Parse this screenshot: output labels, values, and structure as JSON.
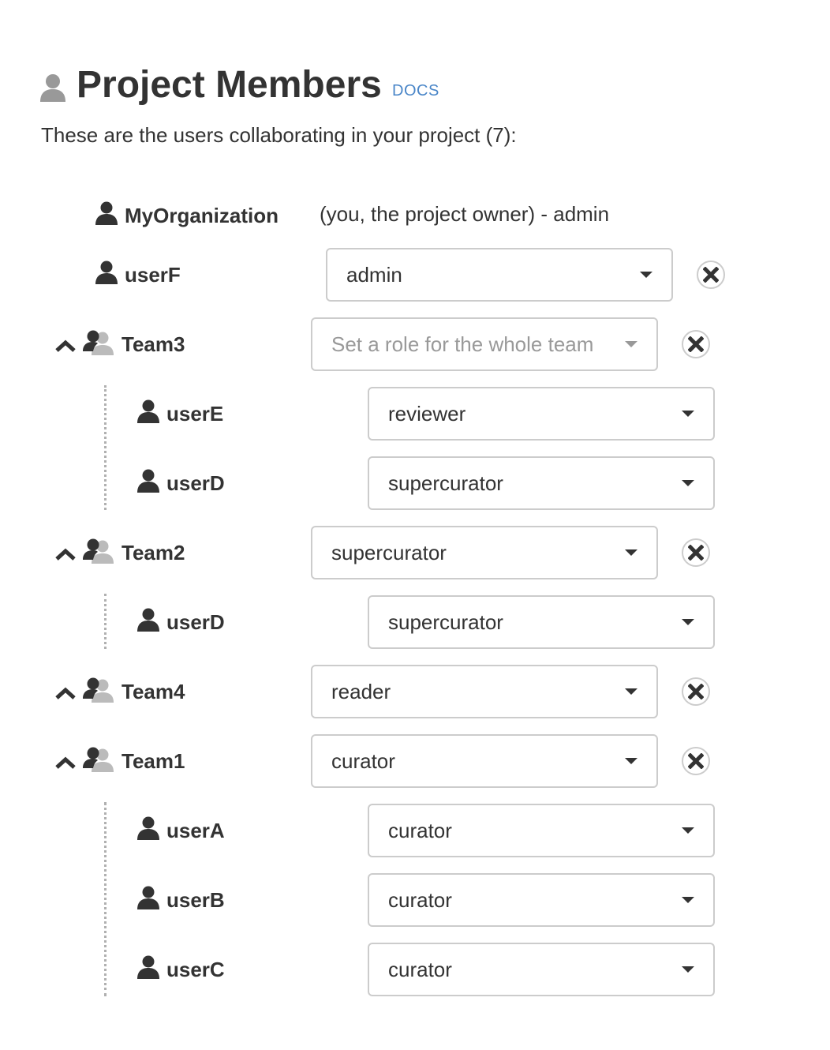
{
  "header": {
    "icon": "user-icon",
    "title": "Project Members",
    "docs_link": "DOCS",
    "subtitle": "These are the users collaborating in your project (7):"
  },
  "owner": {
    "name": "MyOrganization",
    "icon": "user-icon",
    "description": "(you, the project owner) - admin"
  },
  "members": [
    {
      "type": "user",
      "name": "userF",
      "icon": "user-icon",
      "role": "admin",
      "removable": true
    }
  ],
  "teams": [
    {
      "name": "Team3",
      "icon": "team-icon",
      "toggle_icon": "chevron-up-icon",
      "role": "",
      "role_placeholder": "Set a role for the whole team",
      "removable": true,
      "users": [
        {
          "name": "userE",
          "icon": "user-icon",
          "role": "reviewer"
        },
        {
          "name": "userD",
          "icon": "user-icon",
          "role": "supercurator"
        }
      ]
    },
    {
      "name": "Team2",
      "icon": "team-icon",
      "toggle_icon": "chevron-up-icon",
      "role": "supercurator",
      "role_placeholder": "Set a role for the whole team",
      "removable": true,
      "users": [
        {
          "name": "userD",
          "icon": "user-icon",
          "role": "supercurator"
        }
      ]
    },
    {
      "name": "Team4",
      "icon": "team-icon",
      "toggle_icon": "chevron-up-icon",
      "role": "reader",
      "role_placeholder": "Set a role for the whole team",
      "removable": true,
      "users": []
    },
    {
      "name": "Team1",
      "icon": "team-icon",
      "toggle_icon": "chevron-up-icon",
      "role": "curator",
      "role_placeholder": "Set a role for the whole team",
      "removable": true,
      "users": [
        {
          "name": "userA",
          "icon": "user-icon",
          "role": "curator"
        },
        {
          "name": "userB",
          "icon": "user-icon",
          "role": "curator"
        },
        {
          "name": "userC",
          "icon": "user-icon",
          "role": "curator"
        }
      ]
    }
  ],
  "colors": {
    "text": "#333333",
    "link": "#4a86c8",
    "placeholder": "#999999",
    "border": "#cccccc",
    "team_icon_secondary": "#bbbbbb",
    "header_icon": "#999999"
  }
}
